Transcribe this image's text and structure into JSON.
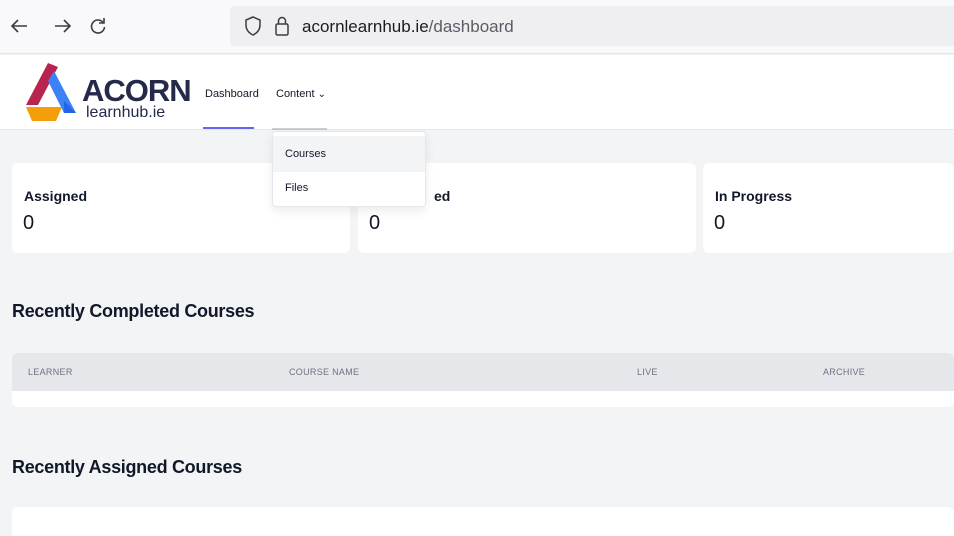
{
  "browser": {
    "url_domain": "acornlearnhub.ie",
    "url_path": "/dashboard"
  },
  "logo": {
    "name": "ACORN",
    "sub": "learnhub.ie"
  },
  "nav": {
    "dashboard": "Dashboard",
    "content": "Content",
    "content_chevron": "⌄"
  },
  "dropdown": {
    "items": [
      "Courses",
      "Files"
    ]
  },
  "cards": [
    {
      "label": "Assigned",
      "value": "0"
    },
    {
      "label": "ed",
      "value": "0"
    },
    {
      "label": "In Progress",
      "value": "0"
    }
  ],
  "sections": {
    "completed_title": "Recently Completed Courses",
    "assigned_title": "Recently Assigned Courses"
  },
  "completed_table": {
    "columns": [
      "LEARNER",
      "COURSE NAME",
      "LIVE",
      "ARCHIVE"
    ]
  },
  "colors": {
    "accent": "#6366f1",
    "logo_red": "#b8234f",
    "logo_blue": "#3b82f6",
    "logo_orange": "#f59e0b"
  }
}
